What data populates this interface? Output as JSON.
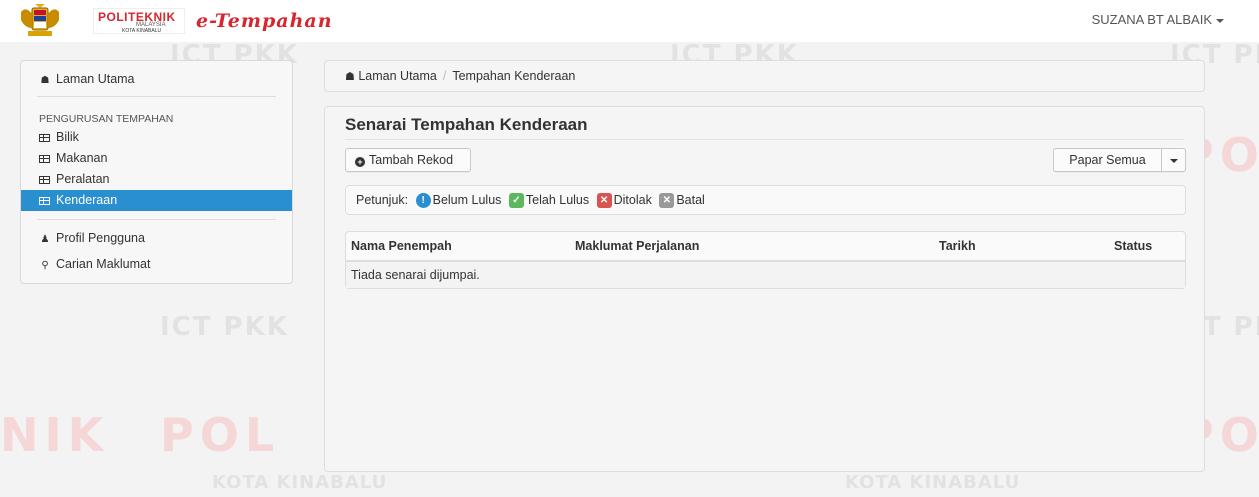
{
  "header": {
    "logo_name": "POLITEKNIK",
    "logo_sub1": "MALAYSIA",
    "logo_sub2": "KOTA KINABALU",
    "brand": "e-Tempahan",
    "user_name": "SUZANA BT ALBAIK"
  },
  "watermarks": {
    "ict": "ICT PKK",
    "kota": "KOTA KINABALU",
    "poli_a": "POL",
    "poli_b": "NIK"
  },
  "sidebar": {
    "home": {
      "label": "Laman Utama",
      "icon": "home-icon"
    },
    "section_header": "PENGURUSAN TEMPAHAN",
    "items": [
      {
        "label": "Bilik",
        "icon": "table-icon",
        "active": false
      },
      {
        "label": "Makanan",
        "icon": "table-icon",
        "active": false
      },
      {
        "label": "Peralatan",
        "icon": "table-icon",
        "active": false
      },
      {
        "label": "Kenderaan",
        "icon": "table-icon",
        "active": true
      }
    ],
    "extra": [
      {
        "label": "Profil Pengguna",
        "icon": "user-icon"
      },
      {
        "label": "Carian Maklumat",
        "icon": "search-icon"
      }
    ]
  },
  "breadcrumb": {
    "home": "Laman Utama",
    "separator": "/",
    "current": "Tempahan Kenderaan"
  },
  "panel": {
    "title": "Senarai Tempahan Kenderaan",
    "add_button": "Tambah Rekod",
    "filter_button": "Papar Semua",
    "legend_label": "Petunjuk:",
    "legend": [
      {
        "label": "Belum Lulus",
        "color": "#2a8fcf",
        "symbol": "!"
      },
      {
        "label": "Telah Lulus",
        "color": "#5cb85c",
        "symbol": "✓"
      },
      {
        "label": "Ditolak",
        "color": "#d9534f",
        "symbol": "✕"
      },
      {
        "label": "Batal",
        "color": "#999999",
        "symbol": "✕"
      }
    ],
    "table": {
      "columns": [
        "Nama Penempah",
        "Maklumat Perjalanan",
        "Tarikh",
        "Status"
      ],
      "empty_message": "Tiada senarai dijumpai."
    }
  }
}
